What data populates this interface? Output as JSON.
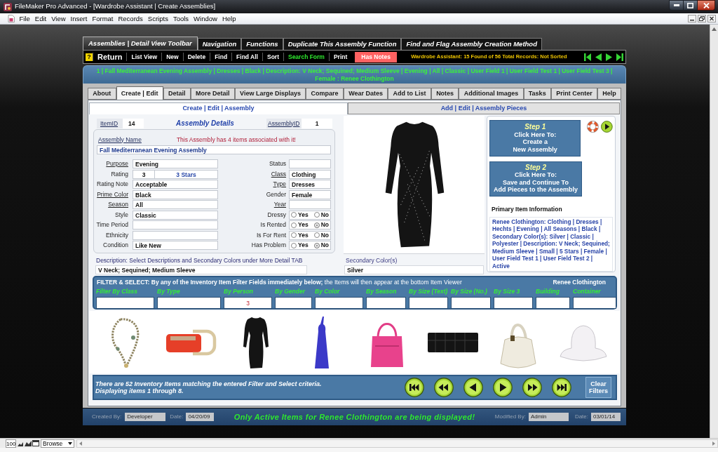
{
  "window": {
    "title": "FileMaker Pro Advanced - [Wardrobe Assistant | Create Assemblies]"
  },
  "menu": [
    "File",
    "Edit",
    "View",
    "Insert",
    "Format",
    "Records",
    "Scripts",
    "Tools",
    "Window",
    "Help"
  ],
  "toolbar_tabs": [
    {
      "label": "Assemblies | Detail View Toolbar",
      "selected": true
    },
    {
      "label": "Navigation",
      "selected": false
    },
    {
      "label": "Functions",
      "selected": false
    },
    {
      "label": "Duplicate This Assembly Function",
      "selected": false
    },
    {
      "label": "Find and Flag Assembly Creation Method",
      "selected": false
    }
  ],
  "toolbar": {
    "help": "?",
    "buttons": [
      {
        "label": "Return",
        "kind": "primary"
      },
      {
        "label": "List View",
        "kind": "plain"
      },
      {
        "label": "New",
        "kind": "plain"
      },
      {
        "label": "Delete",
        "kind": "plain"
      },
      {
        "label": "Find",
        "kind": "plain"
      },
      {
        "label": "Find All",
        "kind": "plain"
      },
      {
        "label": "Sort",
        "kind": "plain"
      },
      {
        "label": "Search Form",
        "kind": "highlight"
      },
      {
        "label": "Print",
        "kind": "plain"
      },
      {
        "label": "Has Notes",
        "kind": "alert"
      }
    ],
    "status": "Wardrobe Assistant: 15 Found of 56 Total Records: Not Sorted"
  },
  "record_summary": "1 | Fall Mediterranean Evening Assembly | Dresses | Black | Description: V Neck; Sequined; Medium Sleeve | Evening | All | Classic | User Field 1 | User Field Test 1 | User Field Test 3 | Female : Renee Clothington",
  "tabs": [
    {
      "label": "About",
      "selected": false
    },
    {
      "label": "Create | Edit",
      "selected": true
    },
    {
      "label": "Detail",
      "selected": false
    },
    {
      "label": "More Detail",
      "selected": false
    },
    {
      "label": "View Large Displays",
      "selected": false
    },
    {
      "label": "Compare",
      "selected": false
    },
    {
      "label": "Wear Dates",
      "selected": false
    },
    {
      "label": "Add to List",
      "selected": false
    },
    {
      "label": "Notes",
      "selected": false
    },
    {
      "label": "Additional Images",
      "selected": false
    },
    {
      "label": "Tasks",
      "selected": false
    },
    {
      "label": "Print Center",
      "selected": false
    },
    {
      "label": "Help",
      "selected": false
    }
  ],
  "subtabs": [
    {
      "label": "Create | Edit | Assembly",
      "selected": true
    },
    {
      "label": "Add | Edit | Assembly Pieces",
      "selected": false
    }
  ],
  "assembly": {
    "item_id": {
      "label": "ItemID",
      "value": "14"
    },
    "heading": "Assembly Details",
    "assembly_id": {
      "label": "AssemblyID",
      "value": "1"
    },
    "name": {
      "label": "Assembly Name",
      "value": "Fall Mediterranean Evening Assembly"
    },
    "items_note": "This Assembly has 4 items associated with it!",
    "fields_left": [
      {
        "kind": "text",
        "label": "Purpose",
        "link": true,
        "value": "Evening"
      },
      {
        "kind": "rating",
        "label": "Rating",
        "link": false,
        "value": "3",
        "display": "3 Stars"
      },
      {
        "kind": "text",
        "label": "Rating Note",
        "link": false,
        "value": "Acceptable"
      },
      {
        "kind": "text",
        "label": "Prime Color",
        "link": true,
        "value": "Black"
      },
      {
        "kind": "text",
        "label": "Season",
        "link": true,
        "value": "All"
      },
      {
        "kind": "text",
        "label": "Style",
        "link": false,
        "value": "Classic"
      },
      {
        "kind": "text",
        "label": "Time Period",
        "link": false
      },
      {
        "kind": "text",
        "label": "Ethnicity",
        "link": false
      },
      {
        "kind": "text",
        "label": "Condition",
        "link": false,
        "value": "Like New"
      }
    ],
    "fields_right": [
      {
        "kind": "text",
        "label": "Status",
        "link": false
      },
      {
        "kind": "text",
        "label": "Class",
        "link": true,
        "value": "Clothing"
      },
      {
        "kind": "text",
        "label": "Type",
        "link": true,
        "value": "Dresses"
      },
      {
        "kind": "text",
        "label": "Gender",
        "link": false,
        "value": "Female"
      },
      {
        "kind": "text",
        "label": "Year",
        "link": true
      },
      {
        "kind": "radio",
        "label": "Dressy",
        "link": false,
        "options": [
          {
            "label": "Yes",
            "selected": false
          },
          {
            "label": "No",
            "selected": false
          }
        ]
      },
      {
        "kind": "radio",
        "label": "Is Rented",
        "link": false,
        "options": [
          {
            "label": "Yes",
            "selected": false
          },
          {
            "label": "No",
            "selected": true
          }
        ]
      },
      {
        "kind": "radio",
        "label": "Is For Rent",
        "link": false,
        "options": [
          {
            "label": "Yes",
            "selected": false
          },
          {
            "label": "No",
            "selected": false
          }
        ]
      },
      {
        "kind": "radio",
        "label": "Has Problem",
        "link": false,
        "options": [
          {
            "label": "Yes",
            "selected": false
          },
          {
            "label": "No",
            "selected": true
          }
        ]
      }
    ]
  },
  "description": {
    "label": "Description: Select Descriptions and Secondary Colors under More Detail TAB",
    "value": "V Neck; Sequined; Medium Sleeve"
  },
  "secondary_colors": {
    "label": "Secondary Color(s)",
    "value": "Silver"
  },
  "steps": [
    {
      "title": "Step 1",
      "lines": [
        "Click Here To:",
        "Create a",
        "New Assembly"
      ]
    },
    {
      "title": "Step 2",
      "lines": [
        "Click Here To:",
        "Save and Continue To",
        "Add Pieces to the Assembly"
      ]
    }
  ],
  "primary_item": {
    "heading": "Primary Item Information",
    "text": "Renee Clothington: Clothing | Dresses | Hechts | Evening | All Seasons | Black | Secondary Color(s): Silver | Classic | Polyester | Description: V Neck; Sequined; Medium Sleeve | Small | 5 Stars | Female | User Field Test 1 | User Field Test 2 | Active"
  },
  "filter": {
    "title": "**FILTER & SELECT: By any of the Inventory Item Filter Fields immediately below;** the Items will then appear at the bottom Item Viewer",
    "person": "Renee Clothington",
    "fields": [
      {
        "label": "Filter By Class"
      },
      {
        "label": "By Type"
      },
      {
        "label": "By Person",
        "value": "3"
      },
      {
        "label": "By Gender"
      },
      {
        "label": "By Color"
      },
      {
        "label": "By Season"
      },
      {
        "label": "By Size (Text)"
      },
      {
        "label": "By Size (No.)"
      },
      {
        "label": "By Size 3"
      },
      {
        "label": "Building"
      },
      {
        "label": "Container"
      }
    ]
  },
  "viewer": {
    "message": [
      "There are 52 Inventory Items matching the entered Filter and Select criteria.",
      "Displaying items 1 through 8."
    ],
    "clear_button": "Clear Filters"
  },
  "footer": {
    "created_by": {
      "label": "Created By:",
      "value": "Developer"
    },
    "created_date": {
      "label": "Date:",
      "value": "04/20/09"
    },
    "message": "Only Active Items for Renee Clothington are being displayed!",
    "modified_by": {
      "label": "Modified By:",
      "value": "Admin"
    },
    "modified_date": {
      "label": "Date:",
      "value": "03/01/14"
    }
  },
  "status_bar": {
    "zoom": "100",
    "mode": "Browse"
  }
}
